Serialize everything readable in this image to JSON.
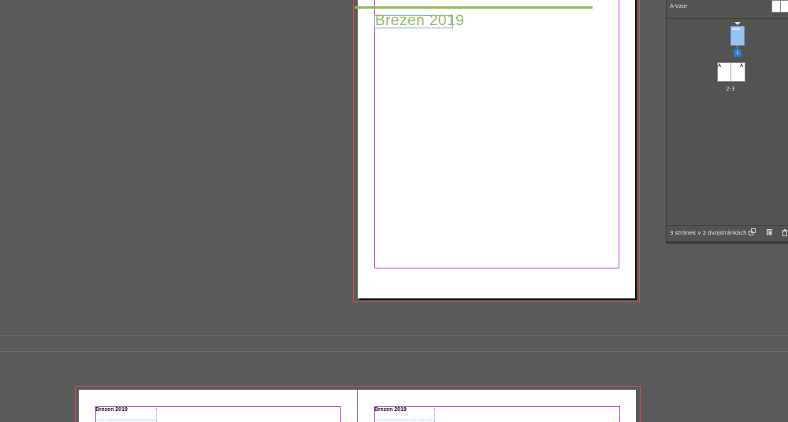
{
  "document": {
    "page1_heading": "Brezen 2019",
    "spread_left_heading": "Brezen 2019",
    "spread_right_heading": "Brezen 2019"
  },
  "pages_panel": {
    "master_label": "A-Vzor",
    "page1_number": "1",
    "spread_letter_left": "A",
    "spread_letter_right": "A",
    "spread_label": "2-3",
    "status_text": "3 stránek v 2 dvojstránkách",
    "icons": {
      "edit_page_size": "page-size-icon",
      "new_page": "new-page-icon",
      "delete_page": "trash-icon"
    }
  },
  "colors": {
    "accent_green": "#90bb5c",
    "bleed_red": "#d24f4f",
    "margin_magenta": "#c23de0",
    "frame_blue": "#7aaad8",
    "selected_page_blue": "#9ac3f1",
    "page_badge_blue": "#2c7ad6",
    "pasteboard": "#5a5a5a",
    "panel_bg": "#535353"
  }
}
